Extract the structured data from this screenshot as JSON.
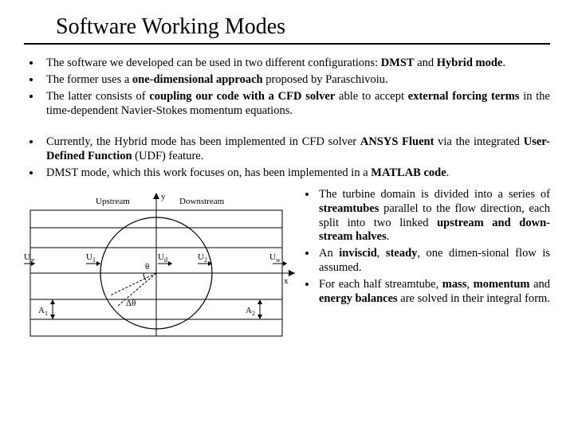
{
  "title": "Software Working Modes",
  "bullets_a": [
    {
      "pre": "The software we developed can be used in two different configurations: ",
      "b1": "DMST",
      "mid": " and ",
      "b2": "Hybrid mode",
      "post": "."
    },
    {
      "pre": "The former uses a ",
      "b1": "one-dimensional approach",
      "mid": " proposed by Paraschivoiu.",
      "b2": "",
      "post": ""
    },
    {
      "pre": "The latter consists of ",
      "b1": "coupling our code with a CFD solver",
      "mid": " able to accept ",
      "b2": "external forcing terms",
      "post": " in the time-dependent Navier-Stokes momentum equations."
    }
  ],
  "bullets_b": [
    {
      "pre": "Currently, the Hybrid mode has been implemented in CFD solver ",
      "b1": "ANSYS Fluent",
      "mid": " via the integrated ",
      "b2": "User-Defined Function",
      "post": " (UDF) feature."
    },
    {
      "pre": "DMST mode, which this work focuses on, has been implemented in a ",
      "b1": "MATLAB code",
      "mid": ".",
      "b2": "",
      "post": ""
    }
  ],
  "bullets_c": [
    {
      "pre": "The turbine domain is divided into a series of ",
      "b1": "streamtubes",
      "mid": " parallel to the flow direction, each split into two linked ",
      "b2": "upstream and down-stream halves",
      "post": "."
    },
    {
      "pre": "An ",
      "b1": "inviscid",
      "mid": ", ",
      "b2": "steady",
      "post": ", one dimen-sional flow is assumed."
    },
    {
      "pre": "For each half streamtube, ",
      "b1": "mass",
      "mid": ", ",
      "b2": "momentum",
      "mid2": " and ",
      "b3": "energy balances",
      "post": " are solved in their integral form."
    }
  ],
  "diagram": {
    "upstream": "Upstream",
    "downstream": "Downstream",
    "y": "y",
    "x": "x",
    "Uinf": "U",
    "inf": "∞",
    "U1": "U",
    "s1": "1",
    "Ud": "U",
    "sd": "d",
    "U2": "U",
    "s2": "2",
    "Uw": "U",
    "sw": "w",
    "theta": "θ",
    "dtheta": "Δθ",
    "A1": "A",
    "sA1": "1",
    "A2": "A",
    "sA2": "2"
  }
}
